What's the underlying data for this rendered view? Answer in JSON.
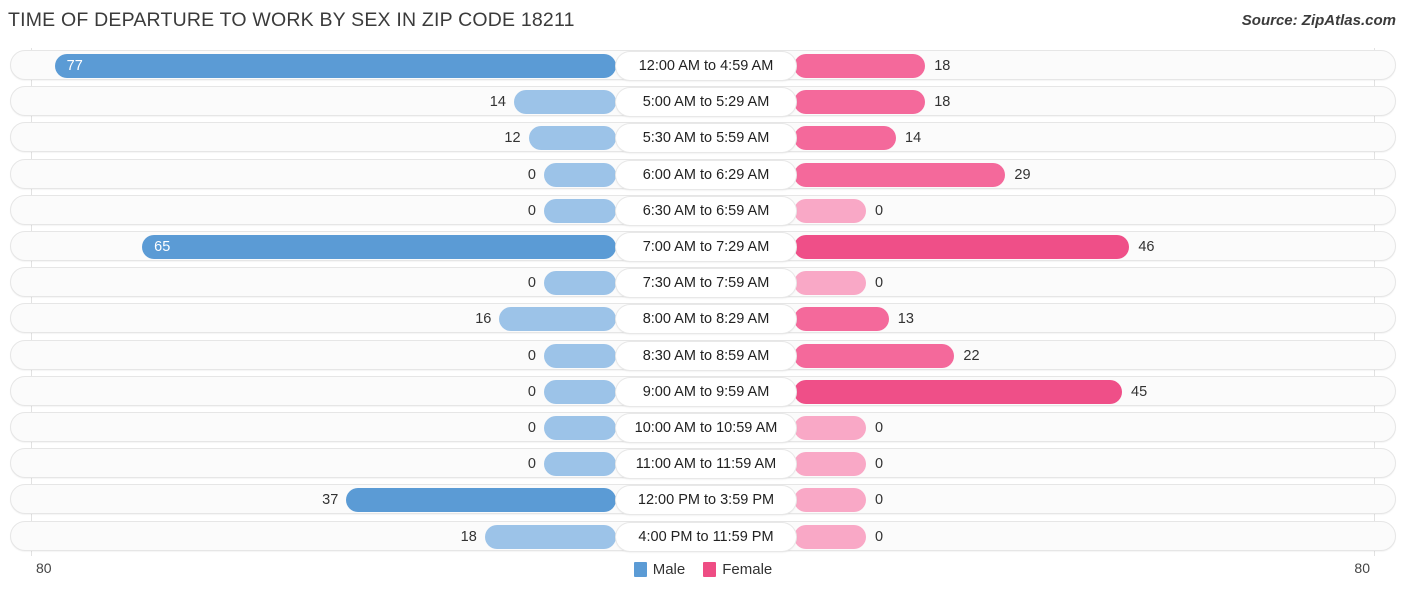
{
  "header": {
    "title": "TIME OF DEPARTURE TO WORK BY SEX IN ZIP CODE 18211",
    "source": "Source: ZipAtlas.com"
  },
  "axis": {
    "left_max": "80",
    "right_max": "80",
    "max_value": 80
  },
  "legend": {
    "items": [
      {
        "label": "Male",
        "color": "#5b9bd5"
      },
      {
        "label": "Female",
        "color": "#ee4d84"
      }
    ]
  },
  "colors": {
    "male_strong": "#5b9bd5",
    "male_light": "#9cc3e8",
    "female_strong": "#ef4f88",
    "female_mid": "#f4699b",
    "female_light": "#f9a8c6",
    "track_bg": "#fbfbfb",
    "track_border": "#e6e6e6",
    "gridline": "#e2e2e2"
  },
  "chart_data": {
    "type": "bar",
    "subtype": "diverging-horizontal-bar",
    "title": "TIME OF DEPARTURE TO WORK BY SEX IN ZIP CODE 18211",
    "xlabel": "",
    "ylabel": "",
    "xlim": [
      -80,
      80
    ],
    "axis_max": 80,
    "grid": true,
    "legend_position": "bottom-center",
    "categories": [
      "12:00 AM to 4:59 AM",
      "5:00 AM to 5:29 AM",
      "5:30 AM to 5:59 AM",
      "6:00 AM to 6:29 AM",
      "6:30 AM to 6:59 AM",
      "7:00 AM to 7:29 AM",
      "7:30 AM to 7:59 AM",
      "8:00 AM to 8:29 AM",
      "8:30 AM to 8:59 AM",
      "9:00 AM to 9:59 AM",
      "10:00 AM to 10:59 AM",
      "11:00 AM to 11:59 AM",
      "12:00 PM to 3:59 PM",
      "4:00 PM to 11:59 PM"
    ],
    "series": [
      {
        "name": "Male",
        "color": "#5b9bd5",
        "values": [
          77,
          14,
          12,
          0,
          0,
          65,
          0,
          16,
          0,
          0,
          0,
          0,
          37,
          18
        ]
      },
      {
        "name": "Female",
        "color": "#ee4d84",
        "values": [
          18,
          18,
          14,
          29,
          0,
          46,
          0,
          13,
          22,
          45,
          0,
          0,
          0,
          0
        ]
      }
    ]
  },
  "rows": [
    {
      "label": "12:00 AM to 4:59 AM",
      "male": "77",
      "female": "18"
    },
    {
      "label": "5:00 AM to 5:29 AM",
      "male": "14",
      "female": "18"
    },
    {
      "label": "5:30 AM to 5:59 AM",
      "male": "12",
      "female": "14"
    },
    {
      "label": "6:00 AM to 6:29 AM",
      "male": "0",
      "female": "29"
    },
    {
      "label": "6:30 AM to 6:59 AM",
      "male": "0",
      "female": "0"
    },
    {
      "label": "7:00 AM to 7:29 AM",
      "male": "65",
      "female": "46"
    },
    {
      "label": "7:30 AM to 7:59 AM",
      "male": "0",
      "female": "0"
    },
    {
      "label": "8:00 AM to 8:29 AM",
      "male": "16",
      "female": "13"
    },
    {
      "label": "8:30 AM to 8:59 AM",
      "male": "0",
      "female": "22"
    },
    {
      "label": "9:00 AM to 9:59 AM",
      "male": "0",
      "female": "45"
    },
    {
      "label": "10:00 AM to 10:59 AM",
      "male": "0",
      "female": "0"
    },
    {
      "label": "11:00 AM to 11:59 AM",
      "male": "0",
      "female": "0"
    },
    {
      "label": "12:00 PM to 3:59 PM",
      "male": "37",
      "female": "0"
    },
    {
      "label": "4:00 PM to 11:59 PM",
      "male": "18",
      "female": "0"
    }
  ]
}
